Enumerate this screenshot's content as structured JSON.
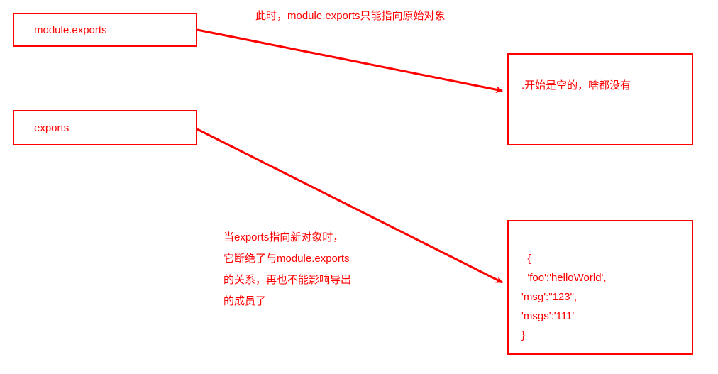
{
  "boxes": {
    "moduleExports": "module.exports",
    "exports": "exports",
    "emptyObject": ".开始是空的，啥都没有",
    "newObject": "{\n  'foo':'helloWorld',\n'msg':\"123\",\n'msgs':'111'\n}"
  },
  "annotations": {
    "top": "此时，module.exports只能指向原始对象",
    "bottom": "当exports指向新对象时，它断绝了与module.exports的关系，再也不能影响导出的成员了"
  },
  "colors": {
    "primary": "#ff0000"
  }
}
